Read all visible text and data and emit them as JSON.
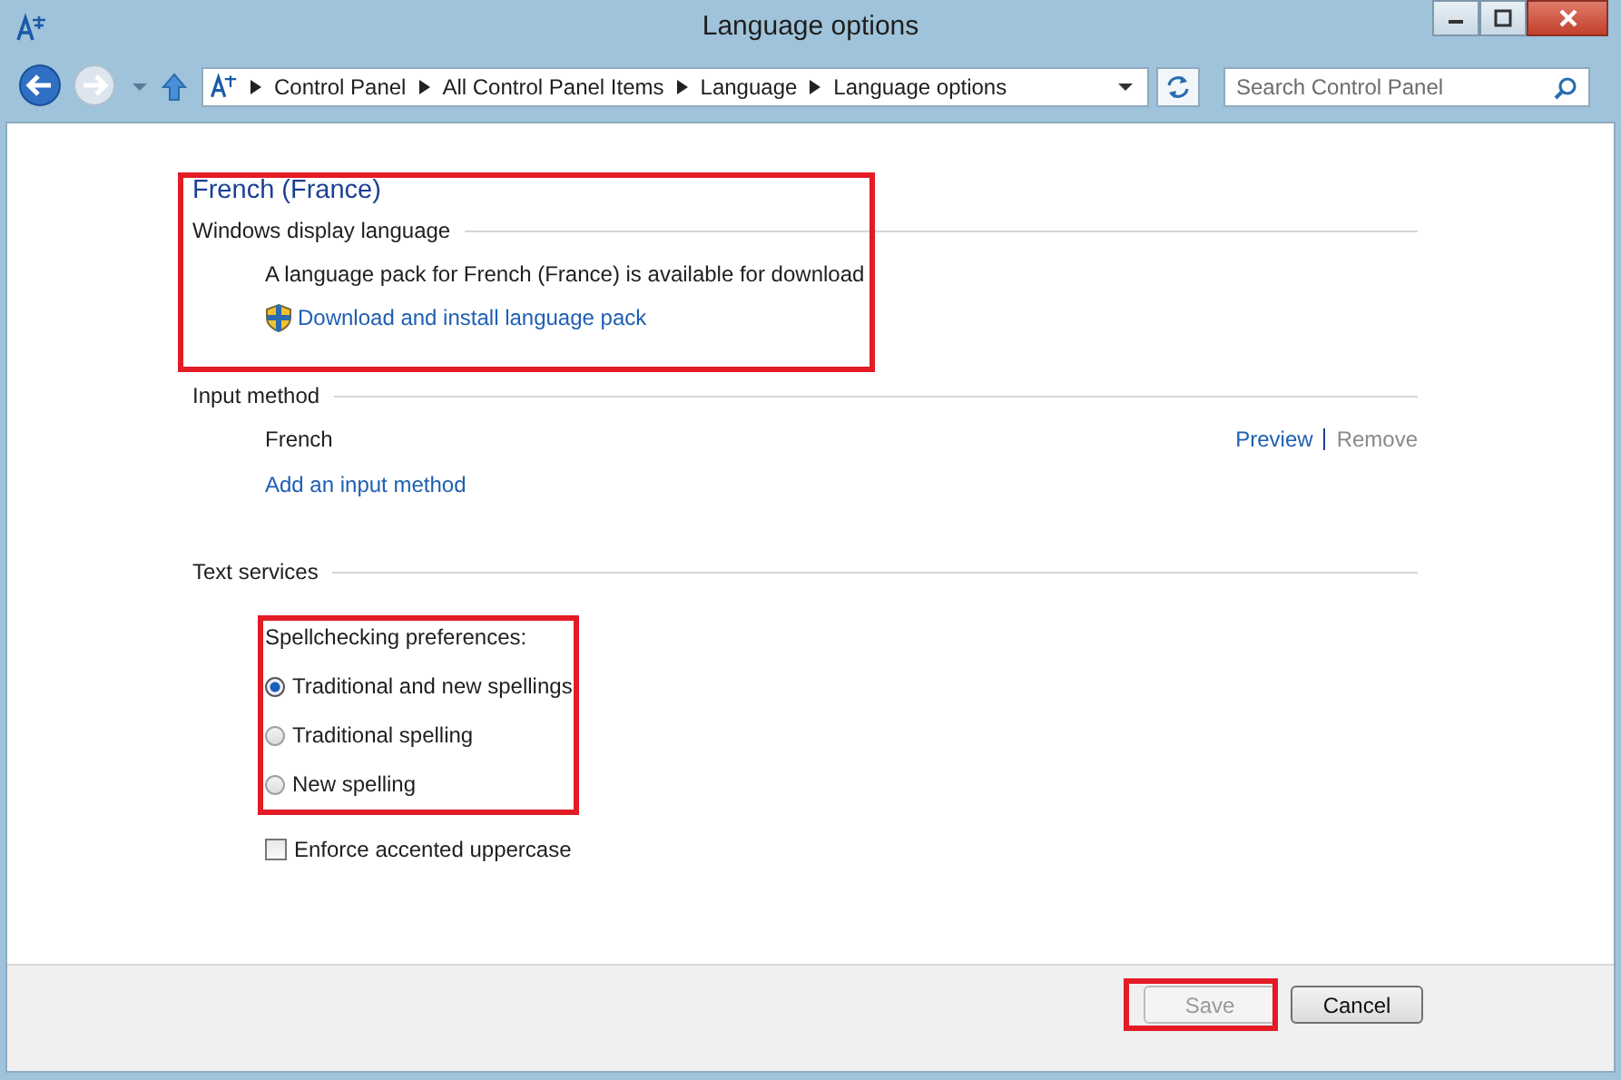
{
  "window": {
    "title": "Language options"
  },
  "breadcrumb": [
    "Control Panel",
    "All Control Panel Items",
    "Language",
    "Language options"
  ],
  "search": {
    "placeholder": "Search Control Panel"
  },
  "language": {
    "title": "French (France)"
  },
  "display_language": {
    "heading": "Windows display language",
    "message": "A language pack for French (France) is available for download",
    "link": "Download and install language pack"
  },
  "input_method": {
    "heading": "Input method",
    "methods": [
      {
        "name": "French",
        "actions": [
          {
            "label": "Preview",
            "disabled": false
          },
          {
            "label": "Remove",
            "disabled": true
          }
        ]
      }
    ],
    "add_link": "Add an input method"
  },
  "text_services": {
    "heading": "Text services",
    "spell_label": "Spellchecking preferences:",
    "options": [
      {
        "label": "Traditional and new spellings",
        "selected": true
      },
      {
        "label": "Traditional spelling",
        "selected": false
      },
      {
        "label": "New spelling",
        "selected": false
      }
    ],
    "checkbox": {
      "label": "Enforce accented uppercase",
      "checked": false
    }
  },
  "buttons": [
    {
      "label": "Save",
      "disabled": true
    },
    {
      "label": "Cancel",
      "disabled": false
    }
  ]
}
